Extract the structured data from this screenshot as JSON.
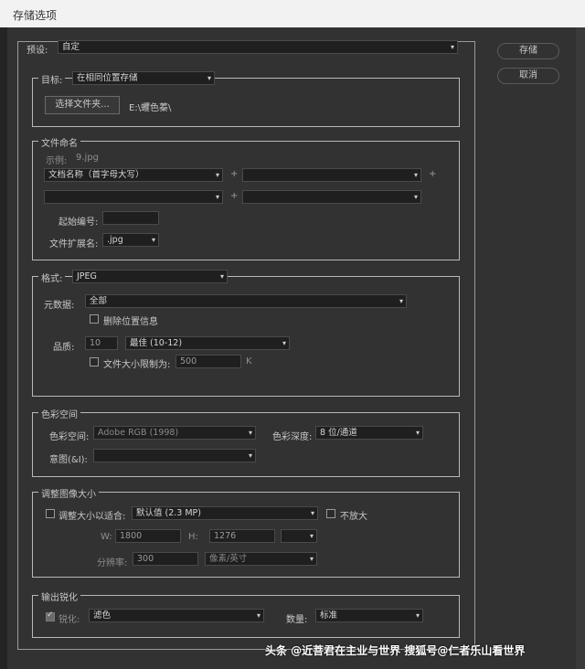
{
  "title": "存储选项",
  "preset": {
    "label": "预设:",
    "value": "自定"
  },
  "buttons": {
    "save": "存储",
    "cancel": "取消"
  },
  "target": {
    "legend": "目标:",
    "value": "在相同位置存储",
    "choose_folder": "选择文件夹...",
    "path": "E:\\蠼色蓁\\"
  },
  "file_naming": {
    "legend": "文件命名",
    "example_label": "示例:",
    "example_value": "9.jpg",
    "field1": "文档名称（首字母大写）",
    "field2": "",
    "field3": "",
    "field4": "",
    "plus": "+",
    "start_number_label": "起始编号:",
    "start_number_value": "",
    "ext_label": "文件扩展名:",
    "ext_value": ".jpg"
  },
  "format": {
    "legend": "格式:",
    "value": "JPEG",
    "metadata_label": "元数据:",
    "metadata_value": "全部",
    "remove_location": "删除位置信息",
    "quality_label": "品质:",
    "quality_value": "10",
    "quality_preset": "最佳  (10-12)",
    "limit_label": "文件大小限制为:",
    "limit_value": "500",
    "limit_unit": "K"
  },
  "color_space": {
    "legend": "色彩空间",
    "space_label": "色彩空间:",
    "space_value": "Adobe RGB (1998)",
    "depth_label": "色彩深度:",
    "depth_value": "8 位/通道",
    "intent_label": "意图(&I):",
    "intent_value": ""
  },
  "resize": {
    "legend": "调整图像大小",
    "fit_label": "调整大小以适合:",
    "fit_value": "默认值 (2.3 MP)",
    "no_enlarge": "不放大",
    "w_label": "W:",
    "w_value": "1800",
    "h_label": "H:",
    "h_value": "1276",
    "unit_value": "",
    "res_label": "分辨率:",
    "res_value": "300",
    "res_unit": "像素/英寸"
  },
  "sharpen": {
    "legend": "输出锐化",
    "sharpen_label": "锐化:",
    "sharpen_value": "滤色",
    "amount_label": "数量:",
    "amount_value": "标准"
  },
  "watermark": "头条 @近菩君在主业与世界 搜狐号@仁者乐山看世界",
  "colors": {
    "bg": "#323232",
    "border": "#b9b9b9",
    "field": "#1f1f1f"
  }
}
